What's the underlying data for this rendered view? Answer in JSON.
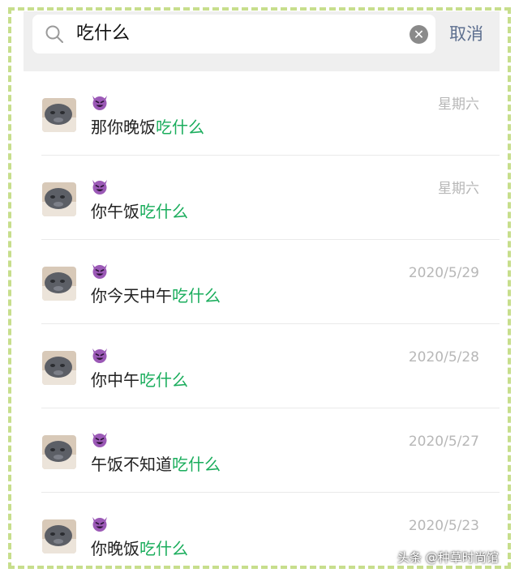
{
  "search": {
    "query": "吃什么",
    "cancel_label": "取消"
  },
  "results": [
    {
      "prefix": "那你晚饭",
      "highlight": "吃什么",
      "date": "星期六",
      "emoji": "smiling-devil-icon"
    },
    {
      "prefix": "你午饭",
      "highlight": "吃什么",
      "date": "星期六",
      "emoji": "smiling-devil-icon"
    },
    {
      "prefix": "你今天中午",
      "highlight": "吃什么",
      "date": "2020/5/29",
      "emoji": "smiling-devil-icon"
    },
    {
      "prefix": "你中午",
      "highlight": "吃什么",
      "date": "2020/5/28",
      "emoji": "smiling-devil-icon"
    },
    {
      "prefix": "午饭不知道",
      "highlight": "吃什么",
      "date": "2020/5/27",
      "emoji": "smiling-devil-icon"
    },
    {
      "prefix": "你晚饭",
      "highlight": "吃什么",
      "date": "2020/5/23",
      "emoji": "smiling-devil-icon"
    }
  ],
  "colors": {
    "highlight": "#1aad5c",
    "frame": "#c7de8c",
    "cancel": "#5d6f8f"
  },
  "watermark": "头条 @种草时尚馆"
}
